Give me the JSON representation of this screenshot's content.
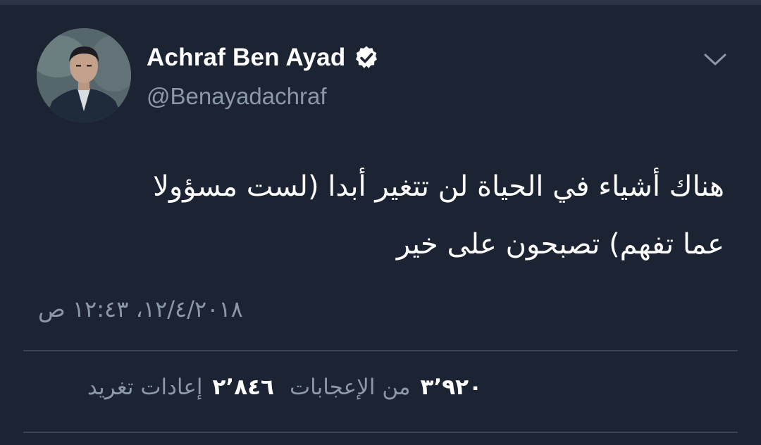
{
  "user": {
    "display_name": "Achraf Ben Ayad",
    "handle": "@Benayadachraf",
    "verified": true,
    "avatar_icon": "profile-photo"
  },
  "menu": {
    "icon": "chevron-down-icon"
  },
  "tweet": {
    "lines": [
      "هناك أشياء في الحياة لن تتغير أبدا  (لست مسؤولا",
      "عما تفهم) تصبحون على خير"
    ],
    "timestamp": "١٢/٤/٢٠١٨، ١٢:٤٣ ص"
  },
  "stats": {
    "likes_count": "٣٬٩٢٠",
    "likes_label": "من الإعجابات",
    "retweets_count": "٢٬٨٤٦",
    "retweets_label": "إعادات تغريد"
  },
  "colors": {
    "background": "#1c2433",
    "primary_text": "#ffffff",
    "secondary_text": "#8b98a7",
    "divider": "#3a4557"
  }
}
